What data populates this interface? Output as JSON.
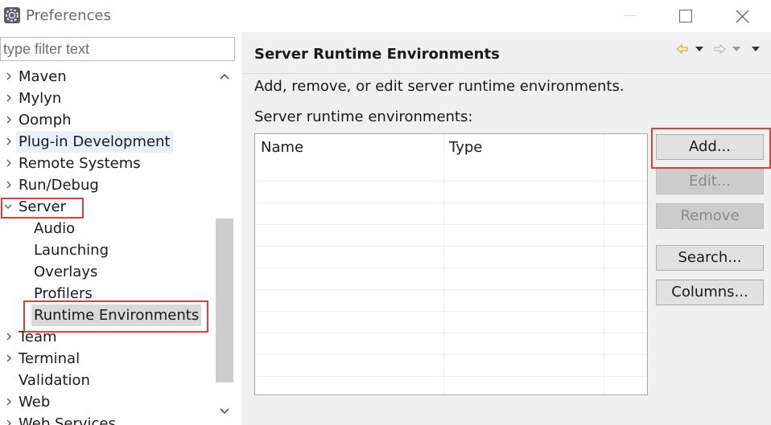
{
  "window": {
    "title": "Preferences"
  },
  "sidebar": {
    "filter_placeholder": "type filter text",
    "items": [
      {
        "label": "Maven",
        "expanded": false
      },
      {
        "label": "Mylyn",
        "expanded": false
      },
      {
        "label": "Oomph",
        "expanded": false
      },
      {
        "label": "Plug-in Development",
        "expanded": false
      },
      {
        "label": "Remote Systems",
        "expanded": false
      },
      {
        "label": "Run/Debug",
        "expanded": false
      },
      {
        "label": "Server",
        "expanded": true
      },
      {
        "label": "Audio"
      },
      {
        "label": "Launching"
      },
      {
        "label": "Overlays"
      },
      {
        "label": "Profilers"
      },
      {
        "label": "Runtime Environments",
        "selected": true
      },
      {
        "label": "Team",
        "expanded": false
      },
      {
        "label": "Terminal",
        "expanded": false
      },
      {
        "label": "Validation"
      },
      {
        "label": "Web",
        "expanded": false
      },
      {
        "label": "Web Services",
        "expanded": false
      }
    ]
  },
  "main": {
    "title": "Server Runtime Environments",
    "description": "Add, remove, or edit server runtime environments.",
    "table_label": "Server runtime environments:",
    "columns": [
      "Name",
      "Type"
    ],
    "rows": [],
    "buttons": {
      "add": "Add...",
      "edit": "Edit...",
      "remove": "Remove",
      "search": "Search...",
      "columns": "Columns..."
    }
  },
  "colors": {
    "highlight_red": "#e0403c",
    "hover_blue": "#e7f1fb",
    "selected_grey": "#d9d9d9"
  }
}
